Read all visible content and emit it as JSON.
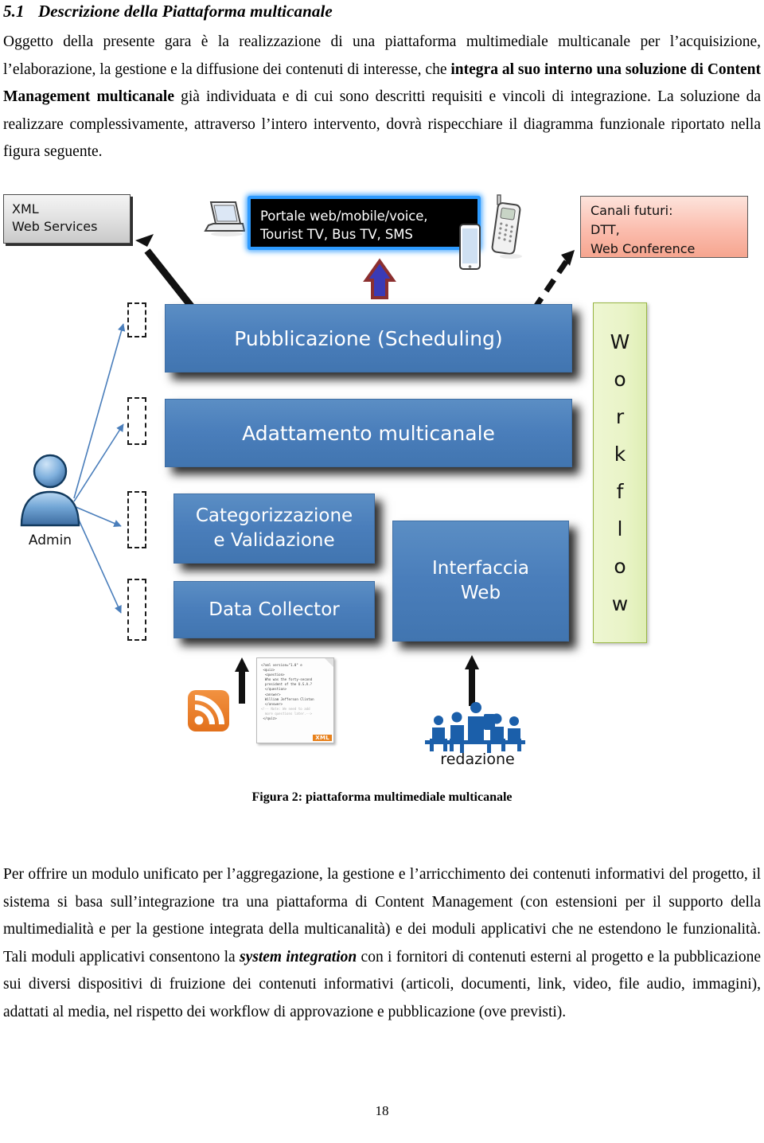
{
  "document": {
    "heading": {
      "number": "5.1",
      "title": "Descrizione della Piattaforma multicanale"
    },
    "intro_paragraph": {
      "part1": "Oggetto della presente gara è la realizzazione di una piattaforma multimediale multicanale per l’acquisizione, l’elaborazione, la gestione e la diffusione dei contenuti di interesse, che ",
      "bold1": "integra al suo interno una soluzione di Content Management multicanale",
      "part2": " già individuata e di cui sono descritti requisiti e vincoli di integrazione. La soluzione da realizzare complessivamente, attraverso l’intero intervento, dovrà rispecchiare il diagramma funzionale riportato nella figura seguente."
    },
    "figure_caption": "Figura 2: piattaforma multimediale multicanale",
    "body_paragraph": {
      "part1": "Per offrire un modulo unificato per l’aggregazione, la gestione e l’arricchimento dei contenuti informativi del progetto, il sistema si basa sull’integrazione tra una piattaforma di Content Management (con estensioni per il supporto della multimedialità e per la gestione integrata della multicanalità) e dei moduli applicativi che ne estendono le funzionalità. Tali moduli applicativi consentono la ",
      "bold_italic": "system integration",
      "part2": " con i fornitori di contenuti esterni al progetto e la pubblicazione sui diversi dispositivi di fruizione dei contenuti informativi (articoli, documenti, link, video, file audio, immagini), adattati al media, nel rispetto dei workflow di approvazione e pubblicazione (ove previsti)."
    },
    "page_number": "18"
  },
  "figure": {
    "xml_web_services": {
      "line1": "XML",
      "line2": "Web Services"
    },
    "portale": {
      "line1": "Portale web/mobile/voice,",
      "line2": "Tourist TV, Bus TV, SMS"
    },
    "canali_futuri": {
      "line1": "Canali futuri:",
      "line2": "DTT,",
      "line3": "Web Conference"
    },
    "boxes": [
      {
        "id": "pubblicazione",
        "label": "Pubblicazione (Scheduling)"
      },
      {
        "id": "adattamento",
        "label": "Adattamento multicanale"
      },
      {
        "id": "categorizzazione",
        "label": "Categorizzazione\ne Validazione"
      },
      {
        "id": "data-collector",
        "label": "Data Collector"
      },
      {
        "id": "interfaccia-web",
        "label": "Interfaccia\nWeb"
      }
    ],
    "workflow_letters": [
      "W",
      "o",
      "r",
      "k",
      "f",
      "l",
      "o",
      "w"
    ],
    "admin_label": "Admin",
    "redazione_label": "redazione",
    "xml_document": {
      "line1": "<?xml version=\"1.0\" e",
      "line2": " <quiz>",
      "line3": "  <question>",
      "line4": "  Who was the forty-second",
      "line5": "  president of the U.S.A.?",
      "line6": "  </question>",
      "line7": "  <answer>",
      "line8": "  William Jefferson Clinton",
      "line9": "  </answer>",
      "line10": "<!-- Note: We need to add",
      "line11": "  more questions later.-->",
      "line12": " </quiz>",
      "badge": "XML"
    },
    "icons": {
      "laptop": "laptop-icon",
      "mobile_phone": "mobile-phone-icon",
      "tablet": "tablet-icon",
      "rss": "rss-icon",
      "team": "team-meeting-icon",
      "admin_user": "user-avatar-icon"
    },
    "colors": {
      "process_box_blue": "#4a7ebb",
      "portale_border_blue": "#2e9bff",
      "canali_pink": "#f6a58f",
      "workflow_green": "#e9f4c7",
      "rss_orange": "#e2701b",
      "arrow_up_fill": "#3a3ab5",
      "arrow_up_stroke": "#8b2f2f",
      "thin_arrow_blue": "#4a7ebb"
    }
  }
}
